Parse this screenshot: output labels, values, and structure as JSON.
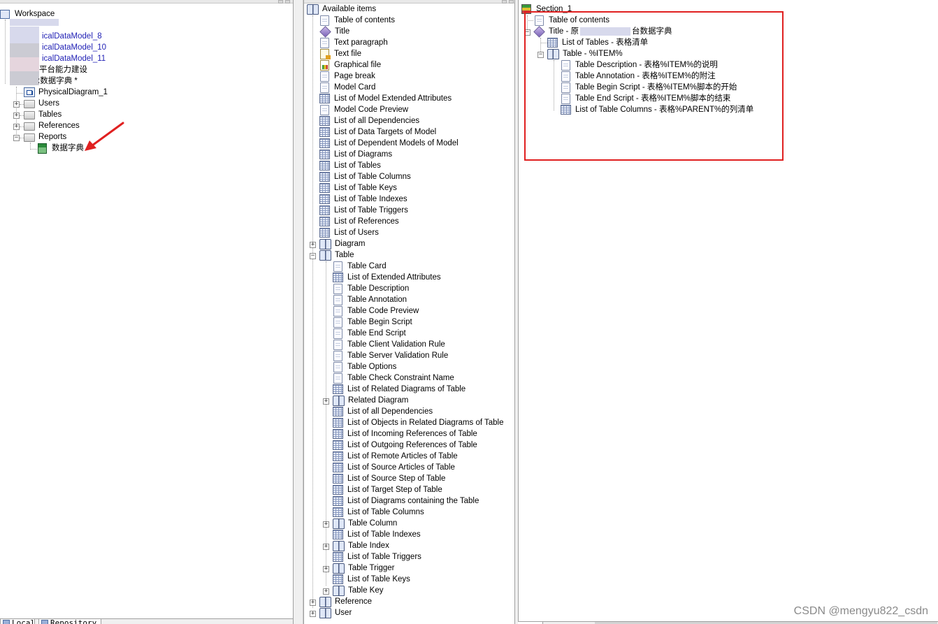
{
  "workspace_tree": {
    "root_label": "Workspace",
    "models": [
      "icalDataModel_8",
      "icalDataModel_10",
      "icalDataModel_11"
    ],
    "project_label": "平台能力建设",
    "model_label": ":数据字典 *",
    "children": [
      "PhysicalDiagram_1",
      "Users",
      "Tables",
      "References",
      "Reports"
    ],
    "report_item": "数据字典"
  },
  "available_items": {
    "root": "Available items",
    "top_items": [
      {
        "label": "Table of contents",
        "icon": "document-icon"
      },
      {
        "label": "Title",
        "icon": "title-icon"
      },
      {
        "label": "Text paragraph",
        "icon": "document-icon"
      },
      {
        "label": "Text file",
        "icon": "text-file-icon"
      },
      {
        "label": "Graphical file",
        "icon": "graphical-file-icon"
      },
      {
        "label": "Page break",
        "icon": "document-icon"
      },
      {
        "label": "Model Card",
        "icon": "document-icon"
      },
      {
        "label": "List of Model Extended Attributes",
        "icon": "list-icon"
      },
      {
        "label": "Model Code Preview",
        "icon": "document-icon"
      },
      {
        "label": "List of all Dependencies",
        "icon": "list-icon"
      },
      {
        "label": "List of Data Targets of Model",
        "icon": "list-icon"
      },
      {
        "label": "List of Dependent Models of Model",
        "icon": "list-icon"
      },
      {
        "label": "List of Diagrams",
        "icon": "list-icon"
      },
      {
        "label": "List of Tables",
        "icon": "list-icon"
      },
      {
        "label": "List of Table Columns",
        "icon": "list-icon"
      },
      {
        "label": "List of Table Keys",
        "icon": "list-icon"
      },
      {
        "label": "List of Table Indexes",
        "icon": "list-icon"
      },
      {
        "label": "List of Table Triggers",
        "icon": "list-icon"
      },
      {
        "label": "List of References",
        "icon": "list-icon"
      },
      {
        "label": "List of Users",
        "icon": "list-icon"
      }
    ],
    "diagram_book": "Diagram",
    "table_book": "Table",
    "table_children": [
      {
        "label": "Table Card",
        "icon": "document-icon",
        "expander": false
      },
      {
        "label": "List of Extended Attributes",
        "icon": "list-icon",
        "expander": false
      },
      {
        "label": "Table Description",
        "icon": "document-icon",
        "expander": false
      },
      {
        "label": "Table Annotation",
        "icon": "document-icon",
        "expander": false
      },
      {
        "label": "Table Code Preview",
        "icon": "document-icon",
        "expander": false
      },
      {
        "label": "Table Begin Script",
        "icon": "document-icon",
        "expander": false
      },
      {
        "label": "Table End Script",
        "icon": "document-icon",
        "expander": false
      },
      {
        "label": "Table Client Validation Rule",
        "icon": "document-icon",
        "expander": false
      },
      {
        "label": "Table Server Validation Rule",
        "icon": "document-icon",
        "expander": false
      },
      {
        "label": "Table Options",
        "icon": "document-icon",
        "expander": false
      },
      {
        "label": "Table Check Constraint Name",
        "icon": "document-icon",
        "expander": false
      },
      {
        "label": "List of Related Diagrams of Table",
        "icon": "list-icon",
        "expander": false
      },
      {
        "label": "Related Diagram",
        "icon": "book-icon",
        "expander": true
      },
      {
        "label": "List of all Dependencies",
        "icon": "list-icon",
        "expander": false
      },
      {
        "label": "List of Objects in Related Diagrams of Table",
        "icon": "list-icon",
        "expander": false
      },
      {
        "label": "List of Incoming References of Table",
        "icon": "list-icon",
        "expander": false
      },
      {
        "label": "List of Outgoing References of Table",
        "icon": "list-icon",
        "expander": false
      },
      {
        "label": "List of Remote Articles of Table",
        "icon": "list-icon",
        "expander": false
      },
      {
        "label": "List of Source Articles of Table",
        "icon": "list-icon",
        "expander": false
      },
      {
        "label": "List of Source Step of Table",
        "icon": "list-icon",
        "expander": false
      },
      {
        "label": "List of Target Step of Table",
        "icon": "list-icon",
        "expander": false
      },
      {
        "label": "List of Diagrams containing the Table",
        "icon": "list-icon",
        "expander": false
      },
      {
        "label": "List of Table Columns",
        "icon": "list-icon",
        "expander": false
      },
      {
        "label": "Table Column",
        "icon": "book-icon",
        "expander": true
      },
      {
        "label": "List of Table Indexes",
        "icon": "list-icon",
        "expander": false
      },
      {
        "label": "Table Index",
        "icon": "book-icon",
        "expander": true
      },
      {
        "label": "List of Table Triggers",
        "icon": "list-icon",
        "expander": false
      },
      {
        "label": "Table Trigger",
        "icon": "book-icon",
        "expander": true
      },
      {
        "label": "List of Table Keys",
        "icon": "list-icon",
        "expander": false
      },
      {
        "label": "Table Key",
        "icon": "book-icon",
        "expander": true
      }
    ],
    "bottom_books": [
      "Reference",
      "User"
    ]
  },
  "report_section": {
    "section": "Section_1",
    "toc": "Table of contents",
    "title_prefix": "Title - 原",
    "title_suffix": "台数据字典",
    "list_of_tables": "List of Tables - 表格清单",
    "table_book": "Table - %ITEM%",
    "table_items": [
      {
        "label": "Table Description - 表格%ITEM%的说明",
        "icon": "document-icon"
      },
      {
        "label": "Table Annotation - 表格%ITEM%的附注",
        "icon": "document-icon"
      },
      {
        "label": "Table Begin Script - 表格%ITEM%脚本的开始",
        "icon": "document-icon"
      },
      {
        "label": "Table End Script - 表格%ITEM%脚本的结束",
        "icon": "document-icon"
      },
      {
        "label": "List of Table Columns - 表格%PARENT%的列清单",
        "icon": "list-icon"
      }
    ]
  },
  "bottom_tabs": {
    "local": "Local",
    "repository": "Repository"
  },
  "watermark": "CSDN @mengyu822_csdn",
  "colors": {
    "highlight": "#e02020",
    "arrow": "#e02020",
    "model_link": "#1f1fb4"
  }
}
